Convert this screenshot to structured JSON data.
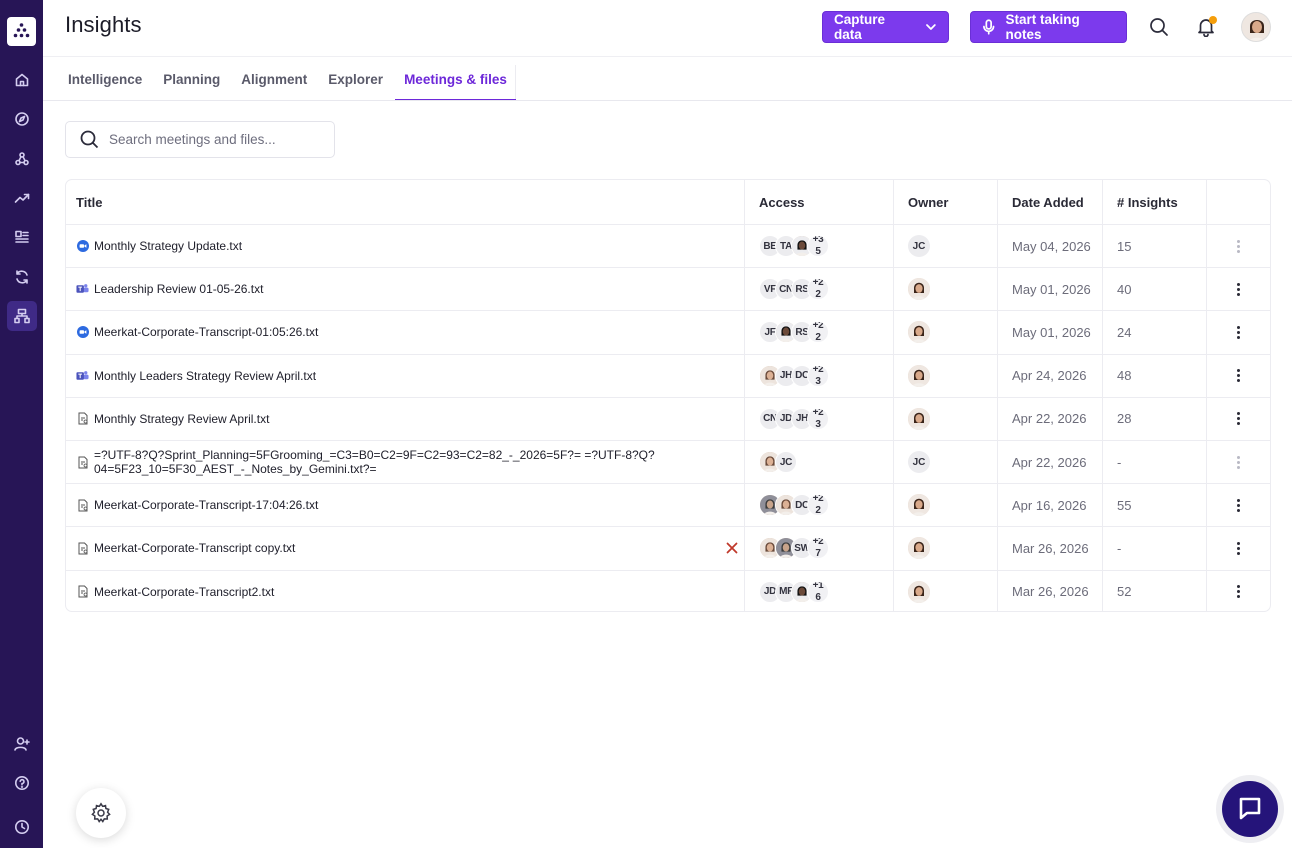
{
  "header": {
    "title": "Insights",
    "capture_label": "Capture data",
    "notes_label": "Start taking notes"
  },
  "tabs": [
    {
      "label": "Intelligence"
    },
    {
      "label": "Planning"
    },
    {
      "label": "Alignment"
    },
    {
      "label": "Explorer"
    },
    {
      "label": "Meetings & files"
    }
  ],
  "search": {
    "placeholder": "Search meetings and files..."
  },
  "table": {
    "columns": {
      "title": "Title",
      "access": "Access",
      "owner": "Owner",
      "date": "Date Added",
      "insights": "# Insights"
    },
    "rows": [
      {
        "title": "Monthly Strategy Update.txt",
        "source": "zoom",
        "access": [
          "BE",
          "TA",
          "photo-dark"
        ],
        "more_top": "+3",
        "more_bottom": "5",
        "owner": "JC",
        "date": "May 04, 2026",
        "insights": "15"
      },
      {
        "title": "Leadership Review 01-05-26.txt",
        "source": "teams",
        "access": [
          "VF",
          "CN",
          "RS"
        ],
        "more_top": "+2",
        "more_bottom": "2",
        "owner": "photo",
        "date": "May 01, 2026",
        "insights": "40"
      },
      {
        "title": "Meerkat-Corporate-Transcript-01:05:26.txt",
        "source": "zoom",
        "access": [
          "JF",
          "photo-dark",
          "RS"
        ],
        "more_top": "+2",
        "more_bottom": "2",
        "owner": "photo",
        "date": "May 01, 2026",
        "insights": "24"
      },
      {
        "title": "Monthly Leaders Strategy Review April.txt",
        "source": "teams",
        "access": [
          "photo",
          "JH",
          "DC"
        ],
        "more_top": "+2",
        "more_bottom": "3",
        "owner": "photo",
        "date": "Apr 24, 2026",
        "insights": "48"
      },
      {
        "title": "Monthly Strategy Review April.txt",
        "source": "file",
        "access": [
          "CN",
          "JD",
          "JH"
        ],
        "more_top": "+2",
        "more_bottom": "3",
        "owner": "photo",
        "date": "Apr 22, 2026",
        "insights": "28"
      },
      {
        "title": "=?UTF-8?Q?Sprint_Planning=5FGrooming_=C3=B0=C2=9F=C2=93=C2=82_-_2026=5F?= =?UTF-8?Q?",
        "title2": "04=5F23_10=5F30_AEST_-_Notes_by_Gemini.txt?=",
        "source": "file",
        "access": [
          "photo",
          "JC"
        ],
        "more_top": "",
        "more_bottom": "",
        "owner": "JC",
        "date": "Apr 22, 2026",
        "insights": "-"
      },
      {
        "title": "Meerkat-Corporate-Transcript-17:04:26.txt",
        "source": "file",
        "access": [
          "photo-gray",
          "photo",
          "DC"
        ],
        "more_top": "+2",
        "more_bottom": "2",
        "owner": "photo",
        "date": "Apr 16, 2026",
        "insights": "55"
      },
      {
        "title": "Meerkat-Corporate-Transcript copy.txt",
        "source": "file",
        "access": [
          "photo",
          "photo-gray",
          "SW"
        ],
        "more_top": "+2",
        "more_bottom": "7",
        "owner": "photo",
        "date": "Mar 26, 2026",
        "insights": "-"
      },
      {
        "title": "Meerkat-Corporate-Transcript2.txt",
        "source": "file",
        "access": [
          "JD",
          "MF",
          "photo-dark"
        ],
        "more_top": "+1",
        "more_bottom": "6",
        "owner": "photo",
        "date": "Mar 26, 2026",
        "insights": "52"
      }
    ]
  },
  "colors": {
    "sidebar": "#271556",
    "accent": "#7c3aed",
    "active_tab": "#6d28d9",
    "notification": "#f59e0b",
    "chat": "#25147a"
  }
}
